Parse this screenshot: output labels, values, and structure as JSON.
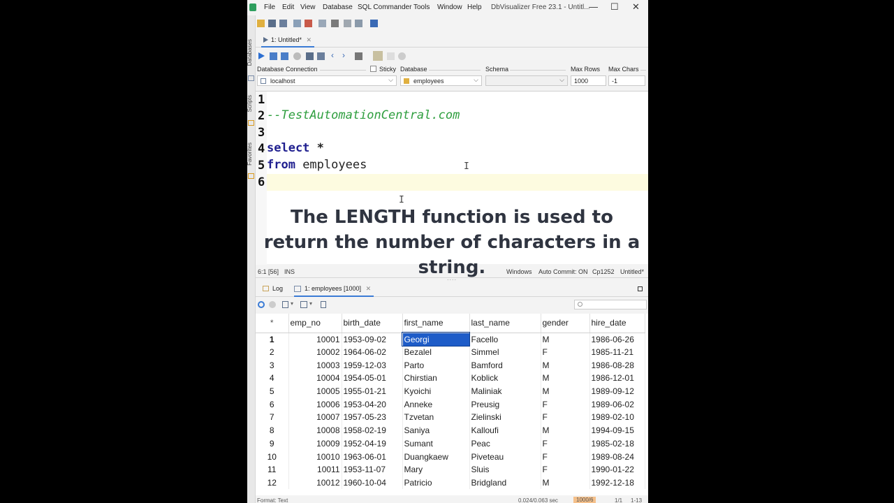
{
  "window": {
    "title": "DbVisualizer Free 23.1 - Untitl...",
    "menus": [
      "File",
      "Edit",
      "View",
      "Database",
      "SQL Commander",
      "Tools",
      "Window",
      "Help"
    ],
    "minimize": "—",
    "maximize": "☐",
    "close": "✕"
  },
  "dock": {
    "databases": "Databases",
    "scripts": "Scripts",
    "favorites": "Favorites"
  },
  "editor_tab": {
    "label": "1: Untitled*",
    "close": "✕"
  },
  "connection": {
    "db_connection_label": "Database Connection",
    "db_connection_value": "localhost",
    "sticky_label": "Sticky",
    "database_label": "Database",
    "database_value": "employees",
    "schema_label": "Schema",
    "schema_value": "",
    "max_rows_label": "Max Rows",
    "max_rows_value": "1000",
    "max_chars_label": "Max Chars",
    "max_chars_value": "-1"
  },
  "editor": {
    "line_numbers": [
      "1",
      "2",
      "3",
      "4",
      "5",
      "6"
    ],
    "comment": "--TestAutomationCentral.com",
    "kw_select": "select",
    "star": " *",
    "kw_from": "from",
    "table": " employees",
    "caption": "The LENGTH function is used to return the number of characters in a string."
  },
  "status": {
    "position": "6:1 [56]",
    "mode": "INS",
    "line_sep": "Windows",
    "auto_commit": "Auto Commit: ON",
    "encoding": "Cp1252",
    "file": "Untitled*"
  },
  "results_tabs": {
    "log": "Log",
    "result": "1: employees [1000]",
    "close": "✕"
  },
  "grid": {
    "row_header": "*",
    "columns": [
      "emp_no",
      "birth_date",
      "first_name",
      "last_name",
      "gender",
      "hire_date"
    ],
    "rows": [
      [
        "1",
        "10001",
        "1953-09-02",
        "Georgi",
        "Facello",
        "M",
        "1986-06-26"
      ],
      [
        "2",
        "10002",
        "1964-06-02",
        "Bezalel",
        "Simmel",
        "F",
        "1985-11-21"
      ],
      [
        "3",
        "10003",
        "1959-12-03",
        "Parto",
        "Bamford",
        "M",
        "1986-08-28"
      ],
      [
        "4",
        "10004",
        "1954-05-01",
        "Chirstian",
        "Koblick",
        "M",
        "1986-12-01"
      ],
      [
        "5",
        "10005",
        "1955-01-21",
        "Kyoichi",
        "Maliniak",
        "M",
        "1989-09-12"
      ],
      [
        "6",
        "10006",
        "1953-04-20",
        "Anneke",
        "Preusig",
        "F",
        "1989-06-02"
      ],
      [
        "7",
        "10007",
        "1957-05-23",
        "Tzvetan",
        "Zielinski",
        "F",
        "1989-02-10"
      ],
      [
        "8",
        "10008",
        "1958-02-19",
        "Saniya",
        "Kalloufi",
        "M",
        "1994-09-15"
      ],
      [
        "9",
        "10009",
        "1952-04-19",
        "Sumant",
        "Peac",
        "F",
        "1985-02-18"
      ],
      [
        "10",
        "10010",
        "1963-06-01",
        "Duangkaew",
        "Piveteau",
        "F",
        "1989-08-24"
      ],
      [
        "11",
        "10011",
        "1953-11-07",
        "Mary",
        "Sluis",
        "F",
        "1990-01-22"
      ],
      [
        "12",
        "10012",
        "1960-10-04",
        "Patricio",
        "Bridgland",
        "M",
        "1992-12-18"
      ]
    ]
  },
  "footer": {
    "format": "Format: Text",
    "timing": "0.024/0.063 sec",
    "rows": "1000/6",
    "pos": "1/1",
    "cols": "1-13"
  },
  "colors": {
    "selection": "#1e5cc8",
    "keyword": "#1f1f8f",
    "comment": "#2e9e3e",
    "current_line": "#fdfbe0"
  }
}
